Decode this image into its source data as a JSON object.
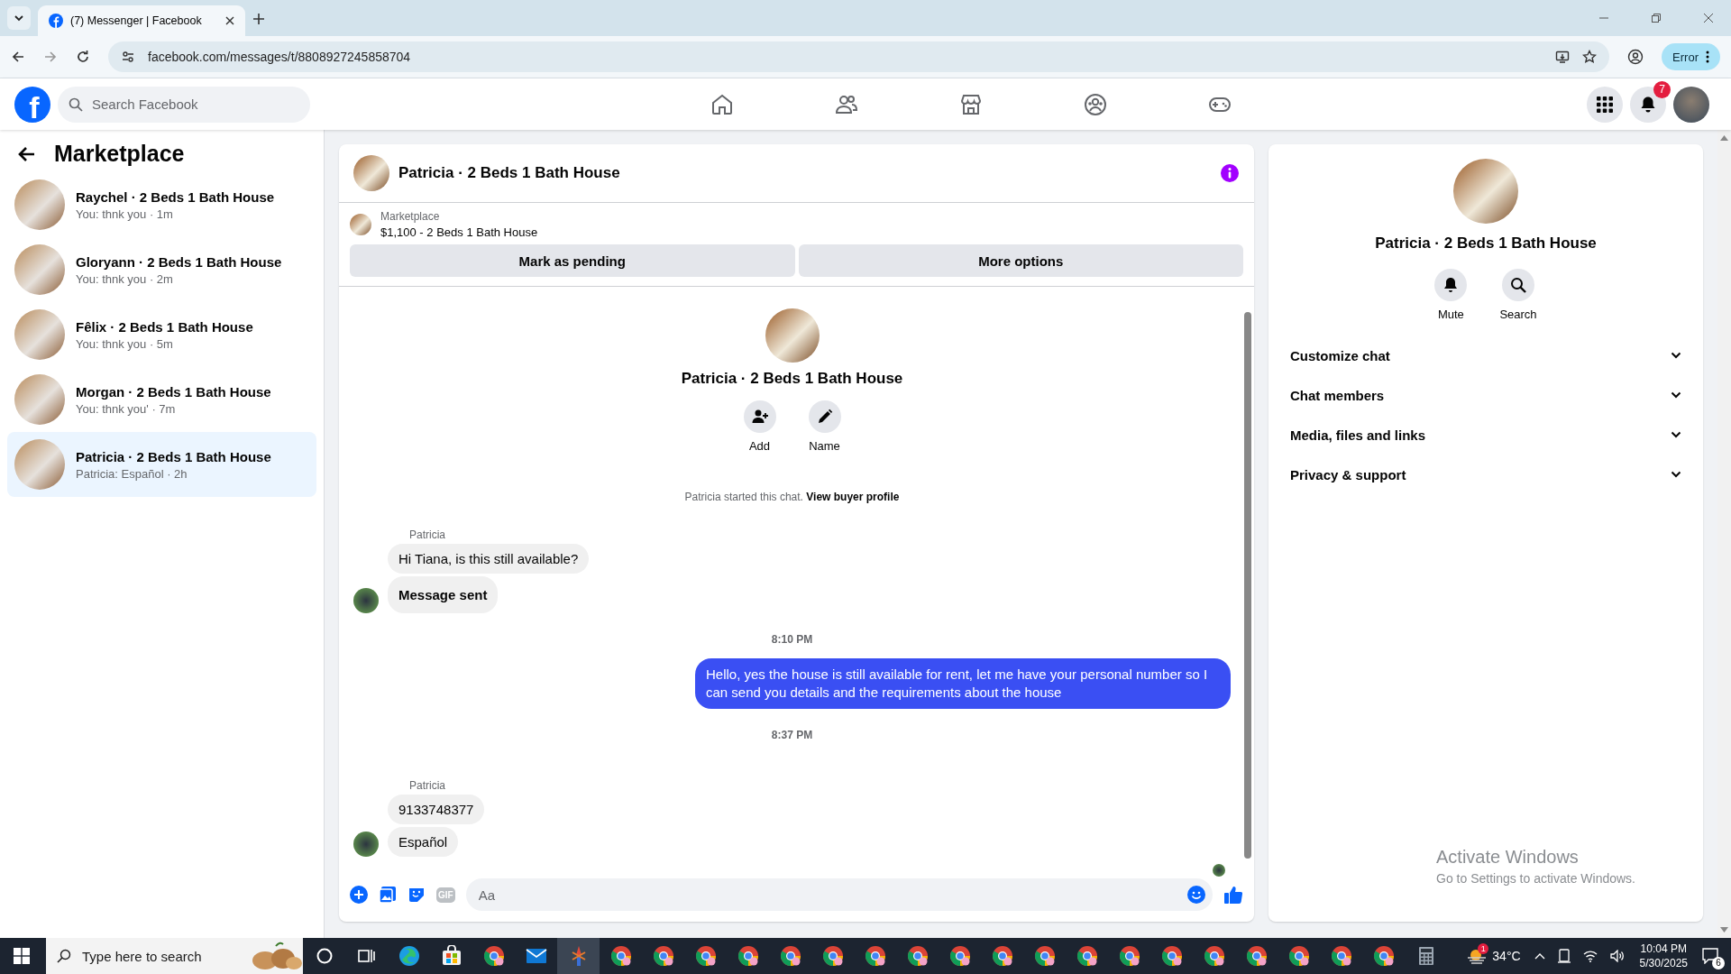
{
  "browser": {
    "tab": {
      "title": "(7) Messenger | Facebook"
    },
    "url": "facebook.com/messages/t/8808927245858704",
    "profile_button": "Error"
  },
  "header": {
    "logo": "f",
    "search": {
      "placeholder": "Search Facebook"
    },
    "nav": [
      {
        "kind": "home"
      },
      {
        "kind": "friends"
      },
      {
        "kind": "marketplace"
      },
      {
        "kind": "groups"
      },
      {
        "kind": "gaming"
      }
    ],
    "notification_count": "7"
  },
  "sidebar": {
    "title": "Marketplace",
    "conversations": [
      {
        "name": "Raychel · 2 Beds 1 Bath House",
        "preview": "You: thnk you · 1m",
        "selected": false
      },
      {
        "name": "Gloryann · 2 Beds 1 Bath House",
        "preview": "You: thnk you · 2m",
        "selected": false
      },
      {
        "name": "Fêlix · 2 Beds 1 Bath House",
        "preview": "You: thnk you · 5m",
        "selected": false
      },
      {
        "name": "Morgan · 2 Beds 1 Bath House",
        "preview": "You: thnk you' · 7m",
        "selected": false
      },
      {
        "name": "Patricia · 2 Beds 1 Bath House",
        "preview": "Patricia: Español · 2h",
        "selected": true
      }
    ]
  },
  "chat": {
    "title": "Patricia · 2 Beds 1 Bath House",
    "listing": {
      "label": "Marketplace",
      "price": "$1,100 - 2 Beds 1 Bath House"
    },
    "actions": [
      "Mark as pending",
      "More options"
    ],
    "profile": {
      "name": "Patricia · 2 Beds 1 Bath House",
      "actions": [
        {
          "kind": "add",
          "label": "Add"
        },
        {
          "kind": "name",
          "label": "Name"
        }
      ]
    },
    "started": {
      "text": "Patricia started this chat.",
      "link": "View buyer profile"
    },
    "messages": [
      {
        "kind": "incoming",
        "sender": "Patricia",
        "bubbles": [
          {
            "text": "Hi Tiana, is this still available?",
            "bold": false
          },
          {
            "text": "Message sent",
            "bold": true
          }
        ]
      },
      {
        "kind": "time",
        "text": "8:10 PM"
      },
      {
        "kind": "outgoing",
        "text": "Hello, yes the house is still available for rent, let me have your personal number so I can send you details and the requirements about the house"
      },
      {
        "kind": "time",
        "text": "8:37 PM"
      },
      {
        "kind": "incoming",
        "sender": "Patricia",
        "bubbles": [
          {
            "text": "9133748377",
            "bold": false
          },
          {
            "text": "Español",
            "bold": false
          }
        ]
      }
    ],
    "composer": {
      "gif_label": "GIF",
      "placeholder": "Aa"
    }
  },
  "details": {
    "name": "Patricia · 2 Beds 1 Bath House",
    "actions": [
      {
        "kind": "mute",
        "label": "Mute"
      },
      {
        "kind": "search",
        "label": "Search"
      }
    ],
    "sections": [
      {
        "label": "Customize chat",
        "expanded": false
      },
      {
        "label": "Chat members",
        "expanded": false
      },
      {
        "label": "Media, files and links",
        "expanded": false
      },
      {
        "label": "Privacy & support",
        "expanded": false
      }
    ]
  },
  "activation": {
    "title": "Activate Windows",
    "subtitle": "Go to Settings to activate Windows."
  },
  "taskbar": {
    "search": {
      "placeholder": "Type here to search"
    },
    "apps": [
      {
        "kind": "cortana",
        "active": false
      },
      {
        "kind": "taskview",
        "active": false
      },
      {
        "kind": "edge",
        "active": false
      },
      {
        "kind": "store",
        "active": false
      },
      {
        "kind": "chrome",
        "active": false
      },
      {
        "kind": "mail",
        "active": false
      },
      {
        "kind": "app",
        "active": true
      },
      {
        "kind": "chrome",
        "active": false
      },
      {
        "kind": "chrome",
        "active": false
      },
      {
        "kind": "chrome",
        "active": false
      },
      {
        "kind": "chrome",
        "active": false
      },
      {
        "kind": "chrome",
        "active": false
      },
      {
        "kind": "chrome",
        "active": false
      },
      {
        "kind": "chrome",
        "active": false
      },
      {
        "kind": "chrome",
        "active": false
      },
      {
        "kind": "chrome",
        "active": false
      },
      {
        "kind": "chrome",
        "active": false
      },
      {
        "kind": "chrome",
        "active": false
      },
      {
        "kind": "chrome",
        "active": false
      },
      {
        "kind": "chrome",
        "active": false
      },
      {
        "kind": "chrome",
        "active": false
      },
      {
        "kind": "chrome",
        "active": false
      },
      {
        "kind": "chrome",
        "active": false
      },
      {
        "kind": "chrome",
        "active": false
      },
      {
        "kind": "chrome",
        "active": false
      },
      {
        "kind": "chrome",
        "active": false
      },
      {
        "kind": "calculator",
        "active": false
      }
    ],
    "weather": {
      "temp": "34°C",
      "badge": "1"
    },
    "time": "10:04 PM",
    "date": "5/30/2025",
    "notifications": "6"
  }
}
